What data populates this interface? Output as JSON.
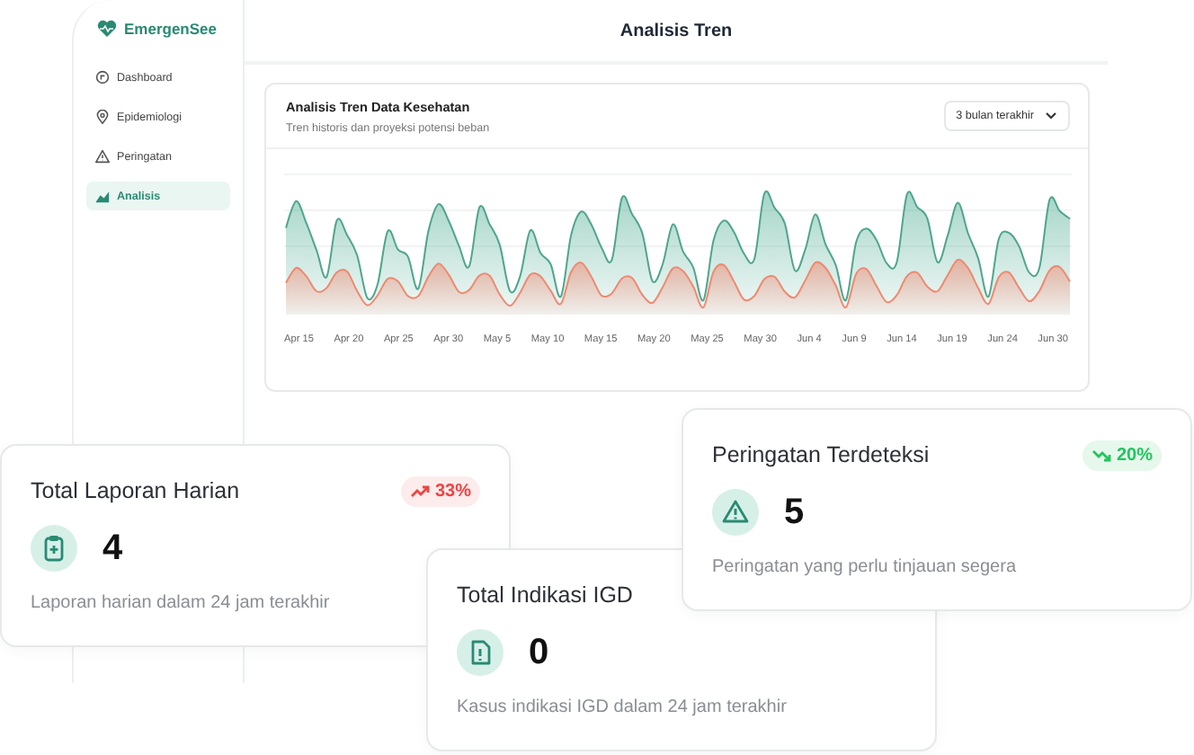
{
  "app": {
    "brand": "EmergenSee",
    "nav": [
      {
        "label": "Dashboard",
        "selected": false
      },
      {
        "label": "Epidemiologi",
        "selected": false
      },
      {
        "label": "Peringatan",
        "selected": false
      },
      {
        "label": "Analisis",
        "selected": true
      }
    ],
    "header": {
      "title": "Analisis Tren"
    },
    "chart_card": {
      "title": "Analisis Tren Data Kesehatan",
      "subtitle": "Tren historis dan proyeksi potensi beban",
      "range": "3 bulan terakhir",
      "x_labels": [
        "Apr 15",
        "Apr 20",
        "Apr 25",
        "Apr 30",
        "May 5",
        "May 10",
        "May 15",
        "May 20",
        "May 25",
        "May 30",
        "Jun 4",
        "Jun 9",
        "Jun 14",
        "Jun 19",
        "Jun 24",
        "Jun 30"
      ]
    }
  },
  "stat_cards": [
    {
      "title": "Total Laporan Harian",
      "value": "4",
      "description": "Laporan harian dalam 24 jam terakhir",
      "trend": {
        "rising": true,
        "label": "33%"
      }
    },
    {
      "title": "Total Indikasi IGD",
      "value": "0",
      "description": "Kasus indikasi IGD dalam 24 jam terakhir"
    },
    {
      "title": "Peringatan Terdeteksi",
      "value": "5",
      "description": "Peringatan yang perlu tinjauan segera",
      "trend": {
        "rising": false,
        "label": "20%"
      }
    }
  ]
}
